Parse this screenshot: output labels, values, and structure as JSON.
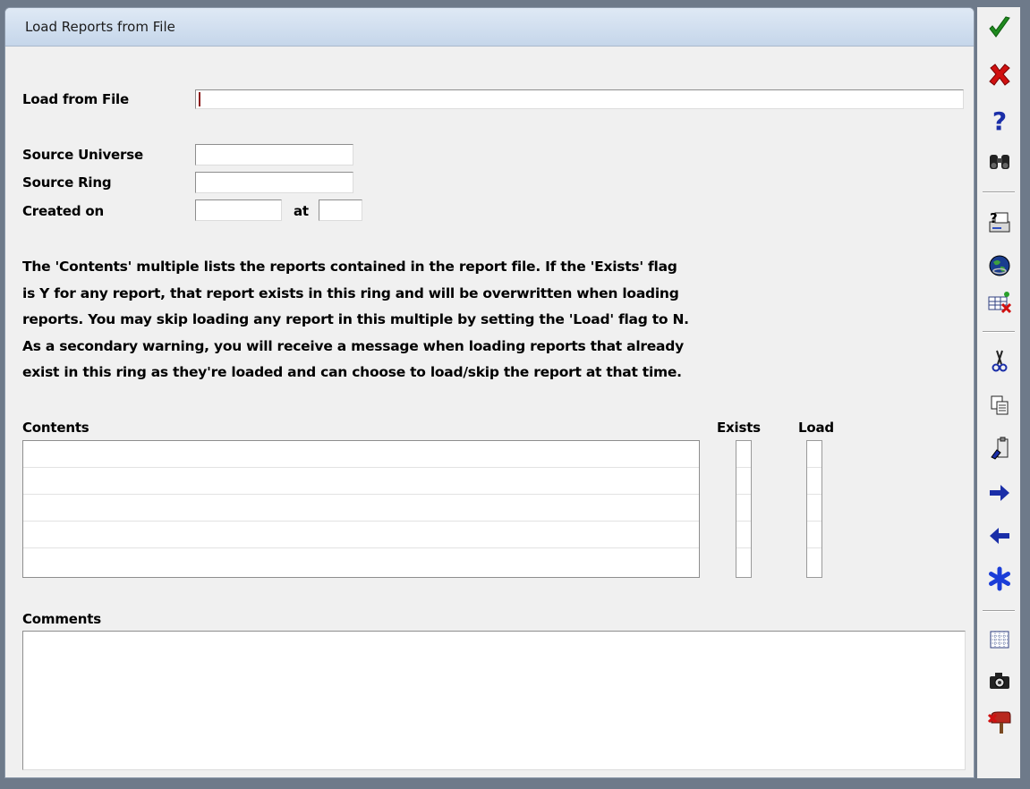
{
  "window": {
    "title": "Load Reports from File"
  },
  "form": {
    "load_from_file_label": "Load from File",
    "load_from_file_value": "",
    "source_universe_label": "Source Universe",
    "source_universe_value": "",
    "source_ring_label": "Source Ring",
    "source_ring_value": "",
    "created_on_label": "Created on",
    "created_on_value": "",
    "at_label": "at",
    "at_value": ""
  },
  "description": [
    "The 'Contents' multiple lists the reports contained in the report file. If the 'Exists' flag",
    "is Y for any report, that report exists in this ring and will be overwritten when loading",
    "reports. You may skip loading any report in this multiple by setting the 'Load' flag to N.",
    "As a secondary warning, you will receive a message when loading reports that already",
    "exist in this ring as they're loaded and can choose to load/skip the report at that time."
  ],
  "contents": {
    "label": "Contents",
    "exists_label": "Exists",
    "load_label": "Load",
    "rows": [
      "",
      "",
      "",
      "",
      ""
    ]
  },
  "comments": {
    "label": "Comments",
    "value": ""
  },
  "toolbar": {
    "icons": [
      "ok-check-icon",
      "cancel-x-icon",
      "help-question-icon",
      "find-binoculars-icon",
      "print-preview-icon",
      "web-globe-icon",
      "table-delete-icon",
      "cut-scissors-icon",
      "copy-icon",
      "paste-icon",
      "next-arrow-icon",
      "previous-arrow-icon",
      "asterisk-icon",
      "spreadsheet-icon",
      "camera-icon",
      "mailbox-icon"
    ]
  }
}
